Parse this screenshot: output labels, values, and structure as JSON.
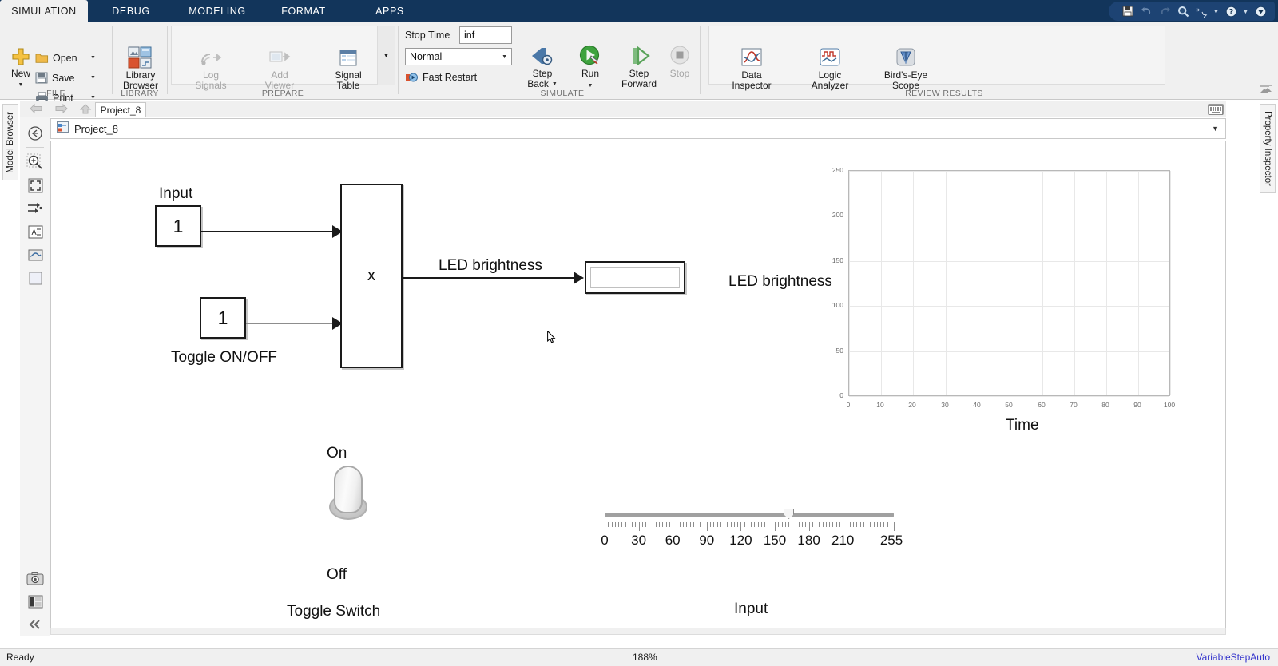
{
  "window": {
    "ribbon_tabs": [
      {
        "label": "SIMULATION",
        "active": true
      },
      {
        "label": "DEBUG",
        "active": false
      },
      {
        "label": "MODELING",
        "active": false
      },
      {
        "label": "FORMAT",
        "active": false
      },
      {
        "label": "APPS",
        "active": false
      }
    ],
    "quick_access": [
      {
        "name": "save-icon",
        "glyph": "💾"
      },
      {
        "name": "undo-icon",
        "glyph": "↶"
      },
      {
        "name": "redo-icon",
        "glyph": "↷"
      },
      {
        "name": "search-icon",
        "glyph": "🔍"
      },
      {
        "name": "shortcuts-icon",
        "glyph": "»"
      },
      {
        "name": "help-icon",
        "glyph": "?"
      },
      {
        "name": "more-icon",
        "glyph": "▼"
      }
    ]
  },
  "ribbon": {
    "groups": [
      {
        "name": "file",
        "label": "FILE"
      },
      {
        "name": "library",
        "label": "LIBRARY"
      },
      {
        "name": "prepare",
        "label": "PREPARE"
      },
      {
        "name": "simulate",
        "label": "SIMULATE"
      },
      {
        "name": "review",
        "label": "REVIEW RESULTS"
      }
    ],
    "file": {
      "new_label": "New",
      "open_label": "Open",
      "save_label": "Save",
      "print_label": "Print"
    },
    "library": {
      "library_browser_line1": "Library",
      "library_browser_line2": "Browser"
    },
    "prepare": {
      "log_signals_line1": "Log",
      "log_signals_line2": "Signals",
      "add_viewer_line1": "Add",
      "add_viewer_line2": "Viewer",
      "signal_table_line1": "Signal",
      "signal_table_line2": "Table"
    },
    "simulate": {
      "stop_time_label": "Stop Time",
      "stop_time_value": "inf",
      "sim_mode_value": "Normal",
      "fast_restart_label": "Fast Restart",
      "step_back_line1": "Step",
      "step_back_line2": "Back",
      "run_label": "Run",
      "step_forward_line1": "Step",
      "step_forward_line2": "Forward",
      "stop_label": "Stop"
    },
    "review": {
      "data_inspector_line1": "Data",
      "data_inspector_line2": "Inspector",
      "logic_analyzer_line1": "Logic",
      "logic_analyzer_line2": "Analyzer",
      "birds_eye_line1": "Bird's-Eye",
      "birds_eye_line2": "Scope"
    }
  },
  "panels": {
    "model_browser_label": "Model Browser",
    "property_inspector_label": "Property Inspector"
  },
  "editor": {
    "file_tab_label": "Project_8",
    "breadcrumb_label": "Project_8"
  },
  "toolstrip_icons": [
    {
      "name": "navigate-back-icon"
    },
    {
      "name": "zoom-in-icon"
    },
    {
      "name": "fit-to-view-icon"
    },
    {
      "name": "signal-routing-icon"
    },
    {
      "name": "annotation-icon"
    },
    {
      "name": "scope-icon"
    },
    {
      "name": "rectangle-icon"
    },
    {
      "name": "screenshot-icon"
    },
    {
      "name": "layout-icon"
    },
    {
      "name": "collapse-icon"
    }
  ],
  "diagram": {
    "input_constant": {
      "label": "Input",
      "value": "1"
    },
    "toggle_constant": {
      "label": "Toggle ON/OFF",
      "value": "1"
    },
    "product_block": {
      "symbol": "x"
    },
    "signal_label": "LED brightness",
    "display_block": {
      "value": ""
    }
  },
  "scope": {
    "y_axis_title": "LED brightness",
    "x_axis_title": "Time",
    "chart_data": {
      "type": "line",
      "title": "",
      "xlabel": "Time",
      "ylabel": "LED brightness",
      "xlim": [
        0,
        100
      ],
      "ylim": [
        0,
        250
      ],
      "xticks": [
        0,
        10,
        20,
        30,
        40,
        50,
        60,
        70,
        80,
        90,
        100
      ],
      "yticks": [
        0,
        50,
        100,
        150,
        200,
        250
      ],
      "grid": true,
      "legend": null,
      "series": [
        {
          "name": "LED brightness",
          "x": [],
          "values": []
        }
      ]
    }
  },
  "toggle_switch": {
    "on_label": "On",
    "off_label": "Off",
    "caption": "Toggle Switch",
    "state": "On"
  },
  "slider": {
    "caption": "Input",
    "min": 0,
    "max": 255,
    "value": 165,
    "ticks": [
      "0",
      "30",
      "60",
      "90",
      "120",
      "150",
      "180",
      "210",
      "255"
    ]
  },
  "statusbar": {
    "status": "Ready",
    "zoom": "188%",
    "solver": "VariableStepAuto"
  }
}
